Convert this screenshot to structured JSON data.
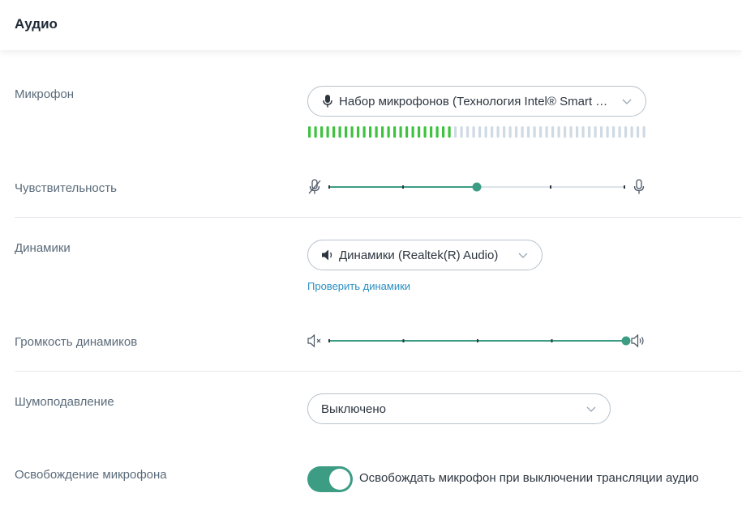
{
  "header": {
    "title": "Аудио"
  },
  "labels": {
    "microphone": "Микрофон",
    "sensitivity": "Чувствительность",
    "speakers": "Динамики",
    "speaker_volume": "Громкость динамиков",
    "noise_suppression": "Шумоподавление",
    "mic_release": "Освобождение микрофона"
  },
  "microphone": {
    "selected": "Набор микрофонов (Технология Intel® Smart Sound)",
    "level_bars_active": 24,
    "level_bars_total": 56
  },
  "sensitivity": {
    "value": 0.5,
    "ticks": 5
  },
  "speakers": {
    "selected": "Динамики (Realtek(R) Audio)",
    "test_link": "Проверить динамики"
  },
  "speaker_volume": {
    "value": 1.0,
    "ticks": 5
  },
  "noise_suppression": {
    "selected": "Выключено"
  },
  "mic_release": {
    "enabled": true,
    "label": "Освобождать микрофон при выключении трансляции аудио"
  },
  "colors": {
    "accent": "#3d9d84",
    "meter_active": "#3fc23f",
    "meter_inactive": "#cfdae3",
    "link": "#2a8fc2"
  }
}
